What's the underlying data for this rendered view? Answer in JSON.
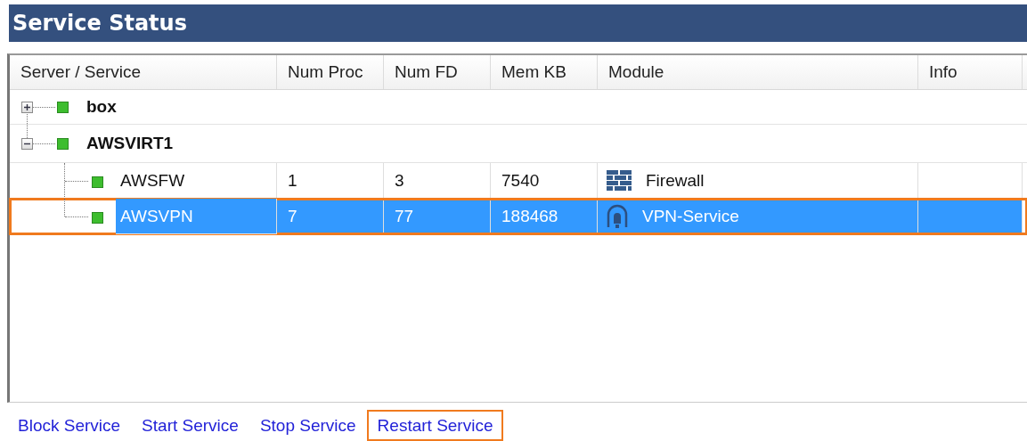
{
  "title": "Service Status",
  "columns": [
    "Server / Service",
    "Num Proc",
    "Num FD",
    "Mem KB",
    "Module",
    "Info"
  ],
  "tree": [
    {
      "name": "box",
      "color": "#3dbd2e",
      "expanded": false,
      "selected": false,
      "highlighted": false
    },
    {
      "name": "AWSVIRT1",
      "color": "#3dbd2e",
      "expanded": true,
      "selected": false,
      "highlighted": false,
      "children": [
        {
          "name": "AWSFW",
          "color": "#3dbd2e",
          "selected": false,
          "highlighted": false,
          "num_proc": "1",
          "num_fd": "3",
          "mem_kb": "7540",
          "module": {
            "kind": "wall",
            "label": "Firewall"
          }
        },
        {
          "name": "AWSVPN",
          "color": "#3dbd2e",
          "selected": true,
          "highlighted": true,
          "num_proc": "7",
          "num_fd": "77",
          "mem_kb": "188468",
          "module": {
            "kind": "tunnel",
            "label": "VPN-Service"
          }
        }
      ]
    }
  ],
  "actions": [
    {
      "label": "Block Service",
      "highlighted": false
    },
    {
      "label": "Start Service",
      "highlighted": false
    },
    {
      "label": "Stop Service",
      "highlighted": false
    },
    {
      "label": "Restart Service",
      "highlighted": true
    }
  ]
}
